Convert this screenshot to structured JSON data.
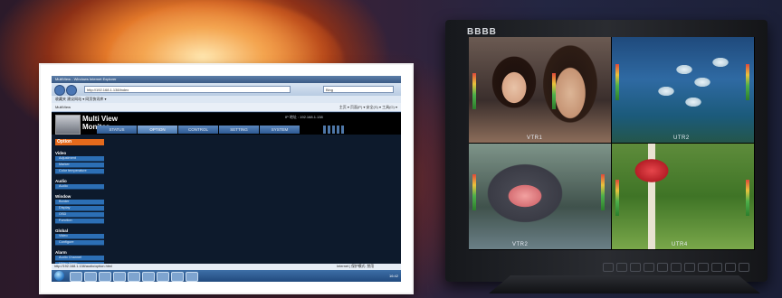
{
  "browser": {
    "title": "MultiView - Windows Internet Explorer",
    "url": "http://192.168.1.138/index",
    "search_placeholder": "Bing",
    "favorites": "收藏夹   建议网站 ▾   网页快讯库 ▾",
    "tab_title": "MultiView",
    "tools": "主页 ▾  页面(P) ▾  安全(S) ▾  工具(O) ▾"
  },
  "app": {
    "title_line1": "Multi View",
    "title_line2": "Monitor",
    "ip_info": "IP 地址 : 192.168.1.138",
    "tabs": [
      "STATUS",
      "OPTION",
      "CONTROL",
      "SETTING",
      "SYSTEM"
    ],
    "active_tab": "OPTION"
  },
  "menu": {
    "title": "Option",
    "groups": [
      {
        "label": "Video",
        "items": [
          "Adjustment",
          "Marker",
          "Color temperature"
        ]
      },
      {
        "label": "Audio",
        "items": [
          "Audio"
        ]
      },
      {
        "label": "Window",
        "items": [
          "Border",
          "Display",
          "OSD",
          "Function"
        ]
      },
      {
        "label": "Global",
        "items": [
          "Video",
          "Configure"
        ]
      },
      {
        "label": "Alarm",
        "items": [
          "Audio Channel",
          "Video Alarm",
          "UMD Audio Alarm",
          "EXT Audio Alarm"
        ]
      }
    ]
  },
  "statusbar": {
    "left": "http://192.168.1.138/audio/option.html",
    "right": "Internet | 保护模式: 禁用"
  },
  "taskbar": {
    "tray": "16:42"
  },
  "monitor": {
    "brand": "BBBB",
    "quadrants": [
      "VTR1",
      "UTR2",
      "VTR2",
      "UTR4"
    ]
  }
}
